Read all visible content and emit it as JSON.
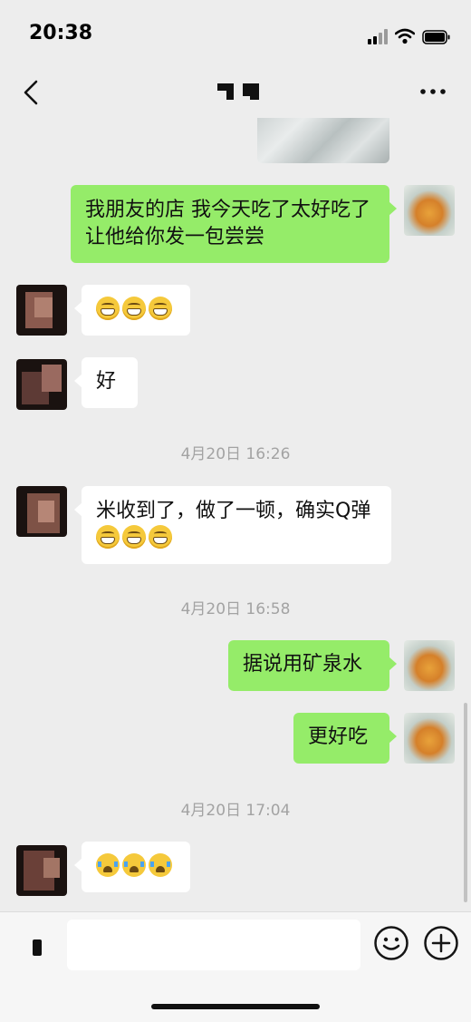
{
  "status_bar": {
    "time": "20:38"
  },
  "header": {
    "title": ""
  },
  "messages": [
    {
      "side": "right",
      "text": "我朋友的店 我今天吃了太好吃了 让他给你发一包尝尝"
    },
    {
      "side": "left",
      "emojis": [
        "grin",
        "grin",
        "grin"
      ]
    },
    {
      "side": "left",
      "text": "好"
    },
    {
      "timestamp": "4月20日 16:26"
    },
    {
      "side": "left",
      "text": "米收到了，做了一顿，确实Q弹",
      "emojis": [
        "grin",
        "grin",
        "grin"
      ]
    },
    {
      "timestamp": "4月20日 16:58"
    },
    {
      "side": "right",
      "text": "据说用矿泉水"
    },
    {
      "side": "right",
      "text": "更好吃"
    },
    {
      "timestamp": "4月20日 17:04"
    },
    {
      "side": "left",
      "emojis": [
        "cry",
        "cry",
        "cry"
      ]
    }
  ],
  "input": {
    "value": "",
    "placeholder": ""
  },
  "icons": {
    "back": "chevron-left-icon",
    "more": "more-dots-icon",
    "emoji": "smiley-icon",
    "add": "plus-circle-icon",
    "voice": "voice-icon"
  },
  "colors": {
    "sent_bubble": "#95ec69",
    "received_bubble": "#ffffff",
    "background": "#ededed",
    "timestamp": "#a3a3a3"
  }
}
